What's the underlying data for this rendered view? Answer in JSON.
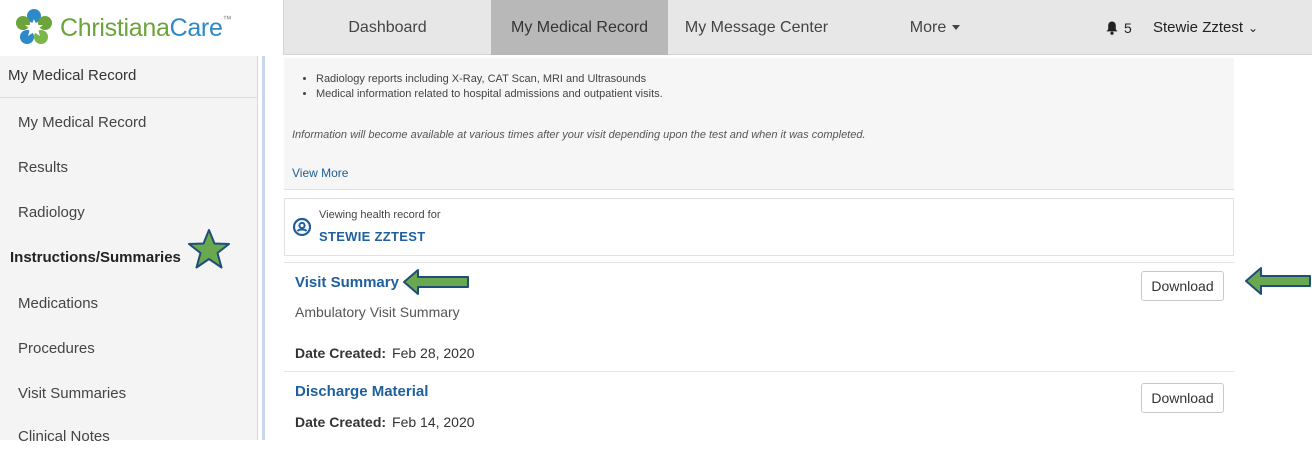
{
  "brand": {
    "name_part1": "Christiana",
    "name_part2": "Care",
    "trademark": "™"
  },
  "nav": {
    "items": [
      {
        "label": "Dashboard"
      },
      {
        "label": "My Medical Record"
      },
      {
        "label": "My Message Center"
      },
      {
        "label": "More"
      }
    ],
    "notifications_count": "5",
    "user_name": "Stewie Zztest"
  },
  "sidebar": {
    "heading": "My Medical Record",
    "items": [
      {
        "label": "My Medical Record"
      },
      {
        "label": "Results"
      },
      {
        "label": "Radiology"
      },
      {
        "label": "Instructions/Summaries"
      },
      {
        "label": "Medications"
      },
      {
        "label": "Procedures"
      },
      {
        "label": "Visit Summaries"
      },
      {
        "label": "Clinical Notes"
      }
    ]
  },
  "info": {
    "bullets": [
      "Radiology reports including X-Ray, CAT Scan, MRI and Ultrasounds",
      "Medical information related to hospital admissions and outpatient visits."
    ],
    "note": "Information will become available at various times after your visit depending upon the test and when it was completed.",
    "view_more": "View More"
  },
  "viewing": {
    "label": "Viewing health record for",
    "patient": "STEWIE ZZTEST"
  },
  "documents": [
    {
      "title": "Visit Summary",
      "subtitle": "Ambulatory Visit Summary",
      "date_label": "Date Created:",
      "date": "Feb 28, 2020",
      "button": "Download"
    },
    {
      "title": "Discharge Material",
      "date_label": "Date Created:",
      "date": "Feb 14, 2020",
      "button": "Download"
    }
  ],
  "colors": {
    "accent_blue": "#1f5f9c",
    "brand_green": "#6ba43a",
    "brand_blue": "#2d89c8",
    "annotation_green": "#6aa84f"
  }
}
